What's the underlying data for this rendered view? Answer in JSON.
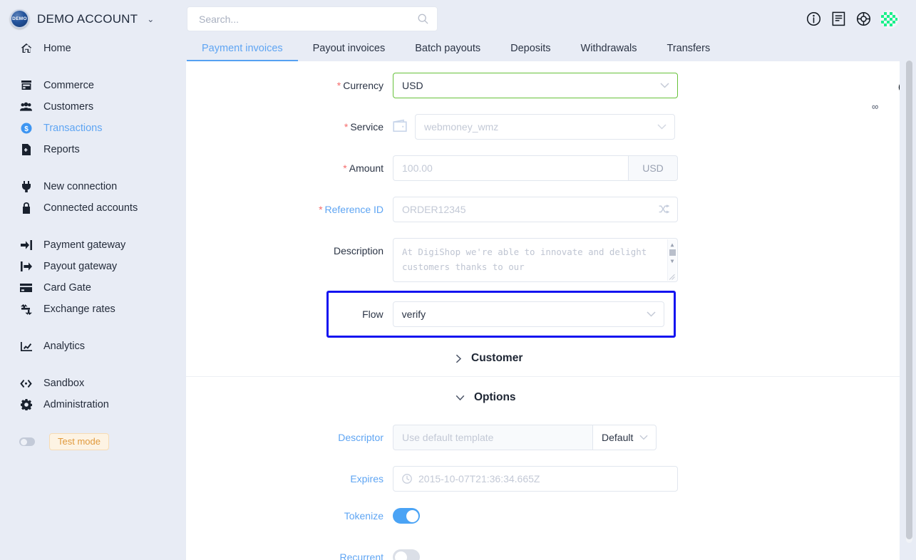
{
  "sidebar": {
    "brand": {
      "logo_text": "DEMO",
      "name": "DEMO ACCOUNT",
      "caret": "⌄"
    },
    "groups": [
      {
        "items": [
          {
            "label": "Home",
            "icon": "home-icon",
            "active": false
          }
        ]
      },
      {
        "items": [
          {
            "label": "Commerce",
            "icon": "store-icon",
            "active": false
          },
          {
            "label": "Customers",
            "icon": "users-icon",
            "active": false
          },
          {
            "label": "Transactions",
            "icon": "dollar-circle-icon",
            "active": true
          },
          {
            "label": "Reports",
            "icon": "report-file-icon",
            "active": false
          }
        ]
      },
      {
        "items": [
          {
            "label": "New connection",
            "icon": "plug-icon",
            "active": false
          },
          {
            "label": "Connected accounts",
            "icon": "lock-icon",
            "active": false
          }
        ]
      },
      {
        "items": [
          {
            "label": "Payment gateway",
            "icon": "arrow-into-bracket-icon",
            "active": false
          },
          {
            "label": "Payout gateway",
            "icon": "arrow-out-bracket-icon",
            "active": false
          },
          {
            "label": "Card Gate",
            "icon": "credit-card-icon",
            "active": false
          },
          {
            "label": "Exchange rates",
            "icon": "exchange-arrows-icon",
            "active": false
          }
        ]
      },
      {
        "items": [
          {
            "label": "Analytics",
            "icon": "chart-line-icon",
            "active": false
          }
        ]
      },
      {
        "items": [
          {
            "label": "Sandbox",
            "icon": "code-brackets-icon",
            "active": false
          },
          {
            "label": "Administration",
            "icon": "gear-icon",
            "active": false
          }
        ]
      }
    ],
    "test_mode": {
      "label": "Test mode",
      "enabled": false
    }
  },
  "topbar": {
    "search": {
      "value": "",
      "placeholder": "Search..."
    },
    "icons": [
      {
        "name": "info-icon"
      },
      {
        "name": "docs-book-icon"
      },
      {
        "name": "lifebuoy-support-icon"
      }
    ],
    "avatar_name": "user-avatar"
  },
  "tabs": [
    {
      "label": "Payment invoices",
      "active": true
    },
    {
      "label": "Payout invoices",
      "active": false
    },
    {
      "label": "Batch payouts",
      "active": false
    },
    {
      "label": "Deposits",
      "active": false
    },
    {
      "label": "Withdrawals",
      "active": false
    },
    {
      "label": "Transfers",
      "active": false
    }
  ],
  "form": {
    "currency": {
      "label": "Currency",
      "required_mark": "*",
      "value": "USD",
      "caret": "⌄",
      "info_icon": "info-circle-icon",
      "infinity_symbol": "∞"
    },
    "service": {
      "label": "Service",
      "required_mark": "*",
      "placeholder": "webmoney_wmz",
      "value": "",
      "caret": "⌄",
      "icon": "wallet-icon"
    },
    "amount": {
      "label": "Amount",
      "required_mark": "*",
      "placeholder": "100.00",
      "value": "",
      "suffix": "USD"
    },
    "reference_id": {
      "label": "Reference ID",
      "required_mark": "*",
      "placeholder": "ORDER12345",
      "value": "",
      "action_icon": "shuffle-icon"
    },
    "description": {
      "label": "Description",
      "placeholder": "At DigiShop we're able to innovate and delight customers thanks to our",
      "value": ""
    },
    "flow": {
      "label": "Flow",
      "value": "verify",
      "caret": "⌄",
      "highlight_color": "#1414f0",
      "highlighted": true
    }
  },
  "sections": {
    "customer": {
      "label": "Customer",
      "expanded": false,
      "chevron": "›"
    },
    "options": {
      "label": "Options",
      "expanded": true,
      "chevron": "⌄"
    }
  },
  "options": {
    "descriptor": {
      "label": "Descriptor",
      "placeholder": "Use default template",
      "value": "",
      "select_value": "Default",
      "caret": "⌄"
    },
    "expires": {
      "label": "Expires",
      "placeholder": "2015-10-07T21:36:34.665Z",
      "value": "",
      "icon": "clock-icon"
    },
    "tokenize": {
      "label": "Tokenize",
      "enabled": true
    },
    "recurrent": {
      "label": "Recurrent",
      "enabled": false
    }
  },
  "colors": {
    "sidebar_bg": "#e8ecf5",
    "accent_blue": "#5fa5f3",
    "required_red": "#f56c6c",
    "valid_green": "#67c23a",
    "highlight_blue": "#1414f0",
    "test_mode_orange": "#e0993c"
  }
}
